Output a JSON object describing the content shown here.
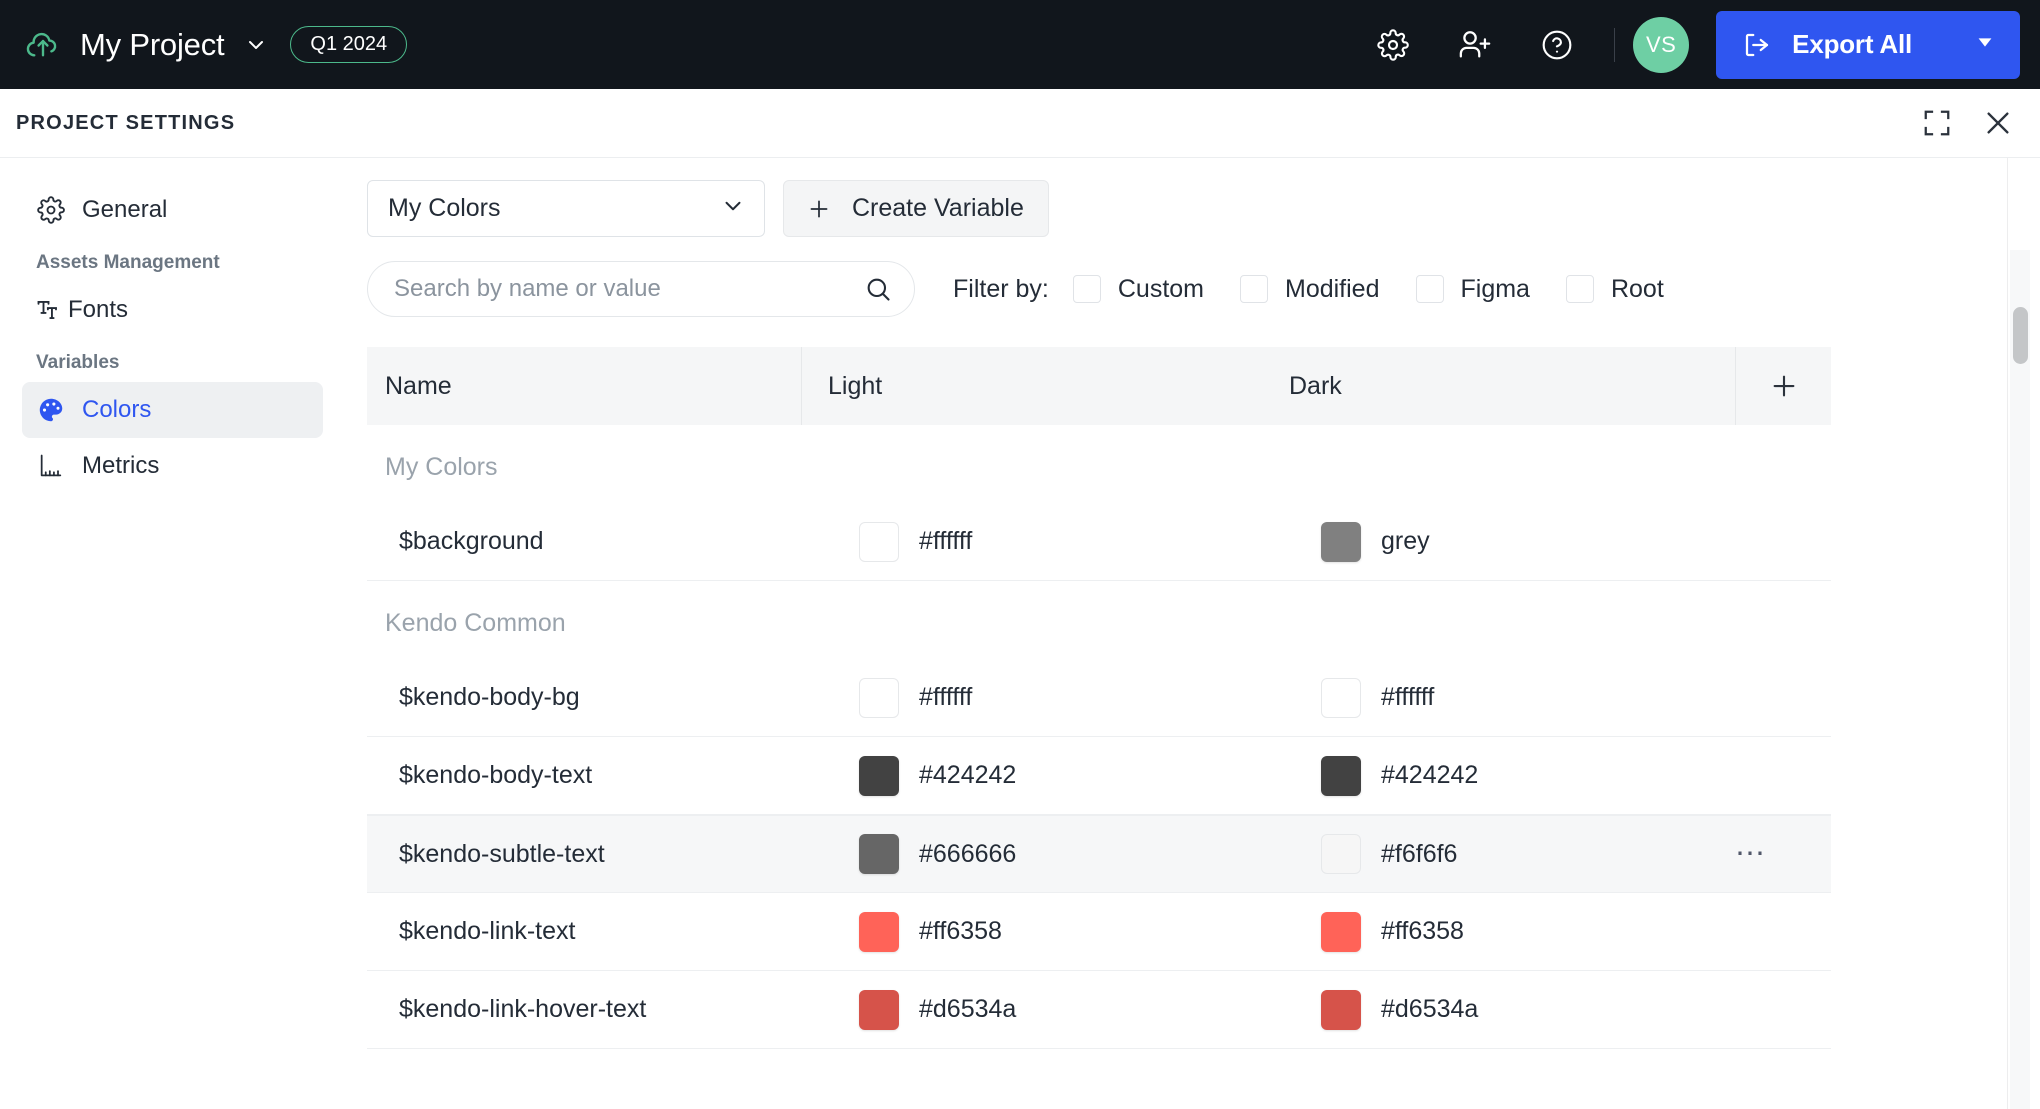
{
  "topbar": {
    "logo_icon": "cloud-upload-icon",
    "project_name": "My Project",
    "project_caret_icon": "chevron-down-icon",
    "version_badge": "Q1 2024",
    "settings_icon": "gear-icon",
    "invite_icon": "user-plus-icon",
    "help_icon": "question-circle-icon",
    "avatar_initials": "VS",
    "export_icon": "export-arrow-icon",
    "export_label": "Export All",
    "export_caret_icon": "caret-down-icon",
    "accent_color": "#2f56f0",
    "avatar_color": "#6ecfa4",
    "badge_border_color": "#4cb98b",
    "bar_color": "#11161c"
  },
  "panel": {
    "title": "PROJECT SETTINGS",
    "expand_icon": "fullscreen-icon",
    "close_icon": "close-icon"
  },
  "sidebar": {
    "items": [
      {
        "label": "General",
        "icon": "gear-icon",
        "type": "item",
        "active": false
      },
      {
        "label": "Assets Management",
        "type": "group"
      },
      {
        "label": "Fonts",
        "icon": "text-type-icon",
        "type": "item",
        "active": false
      },
      {
        "label": "Variables",
        "type": "group"
      },
      {
        "label": "Colors",
        "icon": "palette-icon",
        "type": "item",
        "active": true
      },
      {
        "label": "Metrics",
        "icon": "ruler-icon",
        "type": "item",
        "active": false
      }
    ],
    "active_color": "#2f56f0"
  },
  "toolbar": {
    "collection_select_value": "My Colors",
    "collection_caret_icon": "chevron-down-icon",
    "create_plus_icon": "plus-icon",
    "create_label": "Create Variable"
  },
  "search": {
    "placeholder": "Search by name or value",
    "value": "",
    "icon": "search-icon"
  },
  "filter": {
    "label": "Filter by:",
    "options": [
      {
        "label": "Custom",
        "checked": false
      },
      {
        "label": "Modified",
        "checked": false
      },
      {
        "label": "Figma",
        "checked": false
      },
      {
        "label": "Root",
        "checked": false
      }
    ]
  },
  "table": {
    "headers": {
      "name": "Name",
      "light": "Light",
      "dark": "Dark",
      "add_icon": "plus-icon"
    },
    "groups": [
      {
        "title": "My Colors",
        "rows": [
          {
            "name": "$background",
            "light_swatch": "#ffffff",
            "light_value": "#ffffff",
            "dark_swatch": "#808080",
            "dark_value": "grey",
            "highlighted": false,
            "more_icon": ""
          }
        ]
      },
      {
        "title": "Kendo Common",
        "rows": [
          {
            "name": "$kendo-body-bg",
            "light_swatch": "#ffffff",
            "light_value": "#ffffff",
            "dark_swatch": "#ffffff",
            "dark_value": "#ffffff",
            "highlighted": false,
            "more_icon": ""
          },
          {
            "name": "$kendo-body-text",
            "light_swatch": "#424242",
            "light_value": "#424242",
            "dark_swatch": "#424242",
            "dark_value": "#424242",
            "highlighted": false,
            "more_icon": ""
          },
          {
            "name": "$kendo-subtle-text",
            "light_swatch": "#666666",
            "light_value": "#666666",
            "dark_swatch": "#f6f6f6",
            "dark_value": "#f6f6f6",
            "highlighted": true,
            "more_icon": "⋯"
          },
          {
            "name": "$kendo-link-text",
            "light_swatch": "#ff6358",
            "light_value": "#ff6358",
            "dark_swatch": "#ff6358",
            "dark_value": "#ff6358",
            "highlighted": false,
            "more_icon": ""
          },
          {
            "name": "$kendo-link-hover-text",
            "light_swatch": "#d6534a",
            "light_value": "#d6534a",
            "dark_swatch": "#d6534a",
            "dark_value": "#d6534a",
            "highlighted": false,
            "more_icon": ""
          }
        ]
      }
    ]
  },
  "scrollbar": {
    "name": "vertical-scrollbar"
  }
}
